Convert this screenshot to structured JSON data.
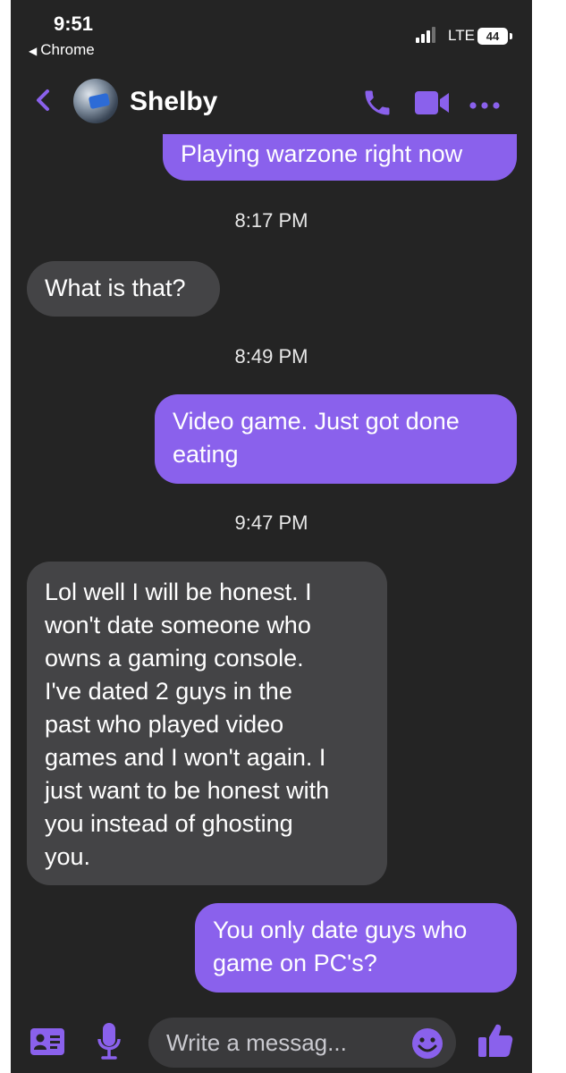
{
  "status_bar": {
    "time": "9:51",
    "back_app": "Chrome",
    "network": "LTE",
    "battery": "44"
  },
  "header": {
    "contact_name": "Shelby"
  },
  "messages": [
    {
      "from": "me",
      "text": "Playing warzone right now"
    },
    {
      "timestamp": "8:17 PM"
    },
    {
      "from": "them",
      "text": "What is that?"
    },
    {
      "timestamp": "8:49 PM"
    },
    {
      "from": "me",
      "lines": [
        "Video game. Just got done",
        "eating"
      ]
    },
    {
      "timestamp": "9:47 PM"
    },
    {
      "from": "them",
      "lines": [
        "Lol well I will be honest. I",
        "won't date someone who",
        "owns a gaming console.",
        "I've dated 2 guys in the",
        "past who played video",
        "games and I won't again. I",
        "just want to be honest with",
        "you instead of ghosting",
        "you."
      ]
    },
    {
      "from": "me",
      "lines": [
        "You only date guys who",
        "game on PC's?"
      ]
    }
  ],
  "composer": {
    "placeholder": "Write a messag..."
  },
  "colors": {
    "accent": "#8a61ec",
    "sent_bubble": "#8a61ec",
    "received_bubble": "#444446",
    "background": "#242424"
  },
  "icons": [
    "chevron-left-icon",
    "phone-icon",
    "video-icon",
    "more-icon",
    "contact-card-icon",
    "microphone-icon",
    "emoji-icon",
    "thumbs-up-icon"
  ]
}
